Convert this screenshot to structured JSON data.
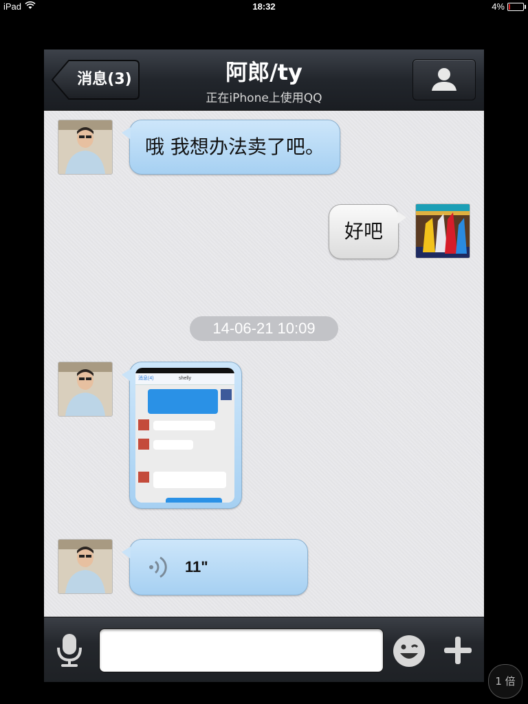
{
  "status_bar": {
    "device": "iPad",
    "time": "18:32",
    "battery_percent": "4%",
    "battery_level": 0.04
  },
  "nav": {
    "back_label": "消息(3)",
    "title": "阿郎/ty",
    "subtitle": "正在iPhone上使用QQ",
    "profile_icon": "person-icon"
  },
  "messages": [
    {
      "direction": "incoming",
      "type": "text",
      "text": "哦 我想办法卖了吧。"
    },
    {
      "direction": "outgoing",
      "type": "text",
      "text": "好吧"
    },
    {
      "type": "timestamp",
      "text": "14-06-21 10:09"
    },
    {
      "direction": "incoming",
      "type": "image",
      "image": {
        "back": "消息(4)",
        "title": "shelly"
      }
    },
    {
      "direction": "incoming",
      "type": "voice",
      "duration": "11\""
    }
  ],
  "input_bar": {
    "mic_icon": "microphone-icon",
    "emoji_icon": "emoji-icon",
    "plus_icon": "plus-icon",
    "value": ""
  },
  "zoom_badge": "1 倍",
  "colors": {
    "incoming_bubble": "#b8dbf6",
    "outgoing_bubble": "#eeeeee",
    "navbar": "#2a2e34"
  }
}
